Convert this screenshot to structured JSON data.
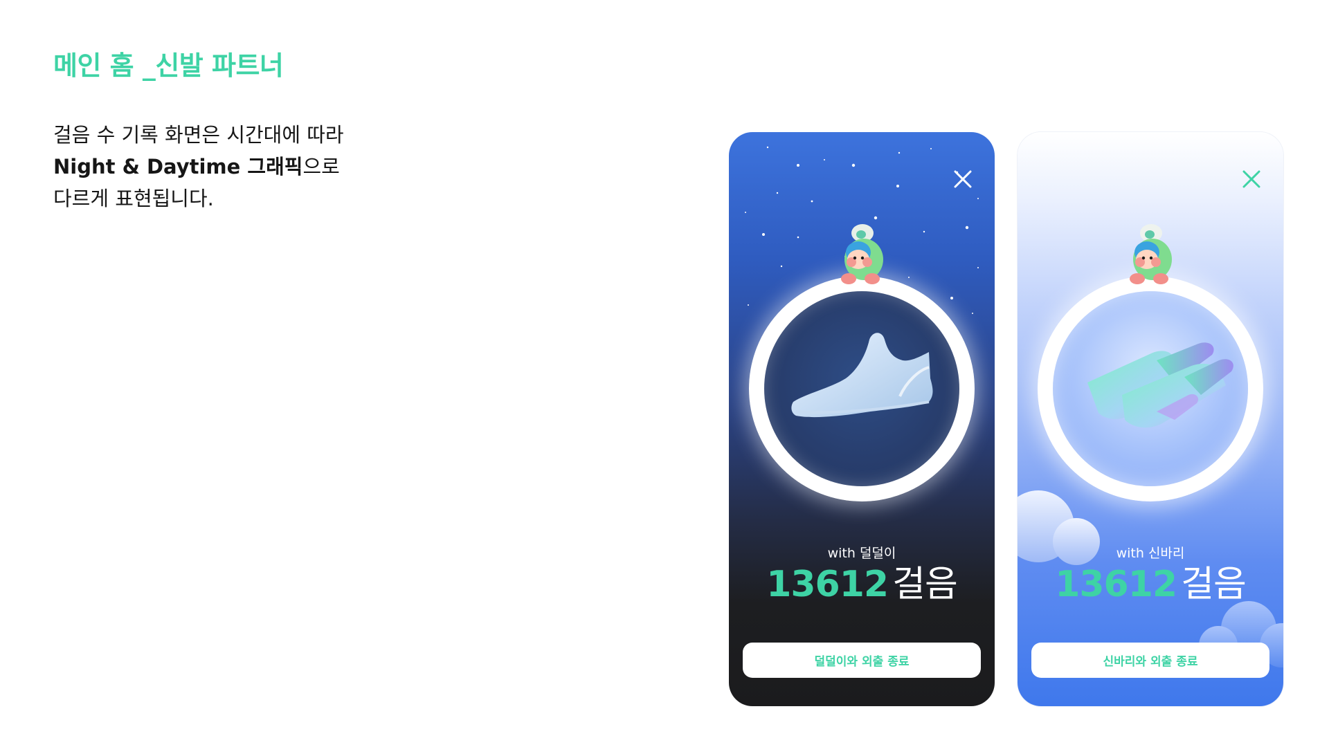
{
  "page": {
    "title": "메인 홈 _신발 파트너",
    "description": {
      "line1": "걸음 수 기록 화면은 시간대에 따라",
      "line2_bold": "Night & Daytime 그래픽",
      "line2_rest": "으로",
      "line3": "다르게 표현됩니다."
    }
  },
  "screens": [
    {
      "mode": "night",
      "with_label": "with 덜덜이",
      "steps_value": "13612",
      "steps_unit": "걸음",
      "end_button": "덜덜이와 외출 종료",
      "shoe_icon": "sneaker-icon"
    },
    {
      "mode": "day",
      "with_label": "with 신바리",
      "steps_value": "13612",
      "steps_unit": "걸음",
      "end_button": "신바리와 외출 종료",
      "shoe_icon": "slipper-icon"
    }
  ],
  "colors": {
    "accent": "#3ed3a5",
    "night_top": "#3d73dd",
    "night_bottom": "#1b1b1d",
    "day_top": "#ffffff",
    "day_bottom": "#3f78ec"
  }
}
